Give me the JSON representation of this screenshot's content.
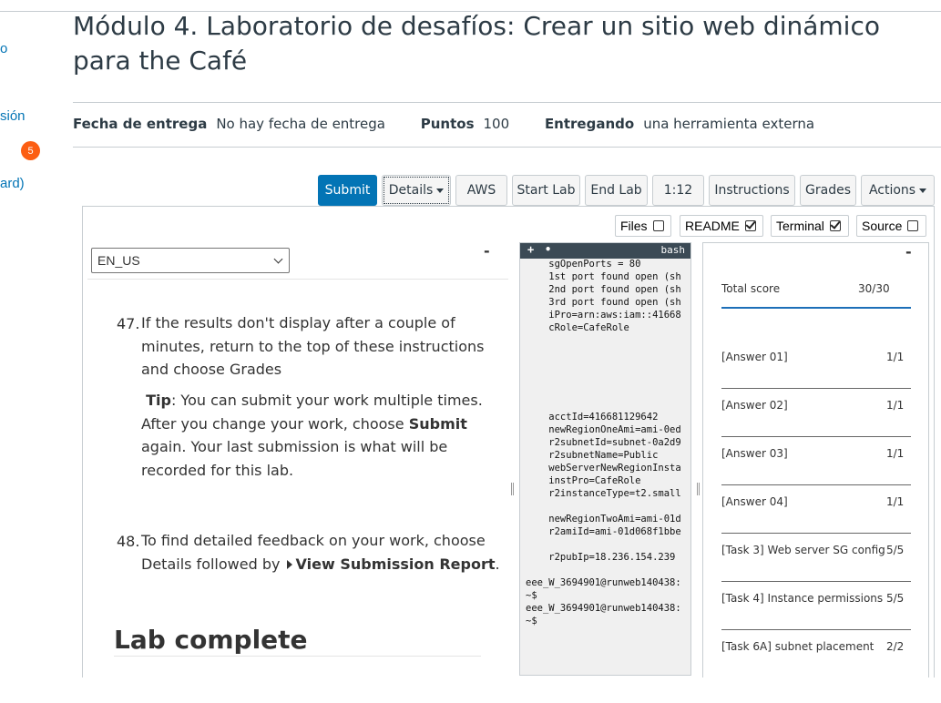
{
  "left_nav": {
    "fragment_1": "o",
    "fragment_2": "sión",
    "badge_count": "5",
    "fragment_3": "ard)"
  },
  "page": {
    "title": "Módulo 4. Laboratorio de desafíos: Crear un sitio web dinámico para the Café"
  },
  "meta": {
    "due_label": "Fecha de entrega",
    "due_value": "No hay fecha de entrega",
    "points_label": "Puntos",
    "points_value": "100",
    "submitting_label": "Entregando",
    "submitting_value": "una herramienta externa"
  },
  "toolbar": {
    "submit": "Submit",
    "details": "Details",
    "aws": "AWS",
    "start_lab": "Start Lab",
    "end_lab": "End Lab",
    "timer": "1:12",
    "instructions": "Instructions",
    "grades": "Grades",
    "actions": "Actions"
  },
  "panel_toggles": {
    "files": {
      "label": "Files",
      "checked": false
    },
    "readme": {
      "label": "README",
      "checked": true
    },
    "terminal": {
      "label": "Terminal",
      "checked": true
    },
    "source": {
      "label": "Source",
      "checked": false
    }
  },
  "readme": {
    "collapse": "-",
    "language": "EN_US",
    "step47_num": "47.",
    "step47_line1": "If the results don't display after a couple of",
    "step47_line2": "minutes, return to the top of these instructions",
    "step47_line3": "and choose Grades",
    "tip_label": "Tip",
    "tip_line1": ": You can submit your work multiple times.",
    "tip_line2a": "After you change your work, choose ",
    "tip_line2b": "Submit",
    "tip_line3": "again. Your last submission is what will be",
    "tip_line4": "recorded for this lab.",
    "step48_num": "48.",
    "step48_line1": "To find detailed feedback on your work, choose",
    "step48_line2a": "Details followed by ",
    "step48_line2b": "View Submission Report",
    "step48_line2c": ".",
    "lab_complete": "Lab complete"
  },
  "terminal": {
    "plus": "+",
    "dot": "•",
    "tab": "bash",
    "lines": [
      "    sgOpenPorts = 80",
      "    1st port found open (sh",
      "    2nd port found open (sh",
      "    3rd port found open (sh",
      "    iPro=arn:aws:iam::41668",
      "    cRole=CafeRole",
      "    acctId=416681129642",
      "    newRegionOneAmi=ami-0ed",
      "    r2subnetId=subnet-0a2d9",
      "    r2subnetName=Public",
      "    webServerNewRegionInsta",
      "    instPro=CafeRole",
      "    r2instanceType=t2.small",
      "    newRegionTwoAmi=ami-01d",
      "    r2amiId=ami-01d068f1bbe",
      "    r2pubIp=18.236.154.239",
      "eee_W_3694901@runweb140438:",
      "~$",
      "eee_W_3694901@runweb140438:",
      "~$"
    ]
  },
  "grades": {
    "collapse": "-",
    "total_label": "Total score",
    "total_value": "30/30",
    "rows": [
      {
        "label": "[Answer 01]",
        "value": "1/1"
      },
      {
        "label": "[Answer 02]",
        "value": "1/1"
      },
      {
        "label": "[Answer 03]",
        "value": "1/1"
      },
      {
        "label": "[Answer 04]",
        "value": "1/1"
      },
      {
        "label": "[Task 3] Web server SG config",
        "value": "5/5"
      },
      {
        "label": "[Task 4] Instance permissions",
        "value": "5/5"
      },
      {
        "label": "[Task 6A] subnet placement",
        "value": "2/2"
      }
    ]
  }
}
